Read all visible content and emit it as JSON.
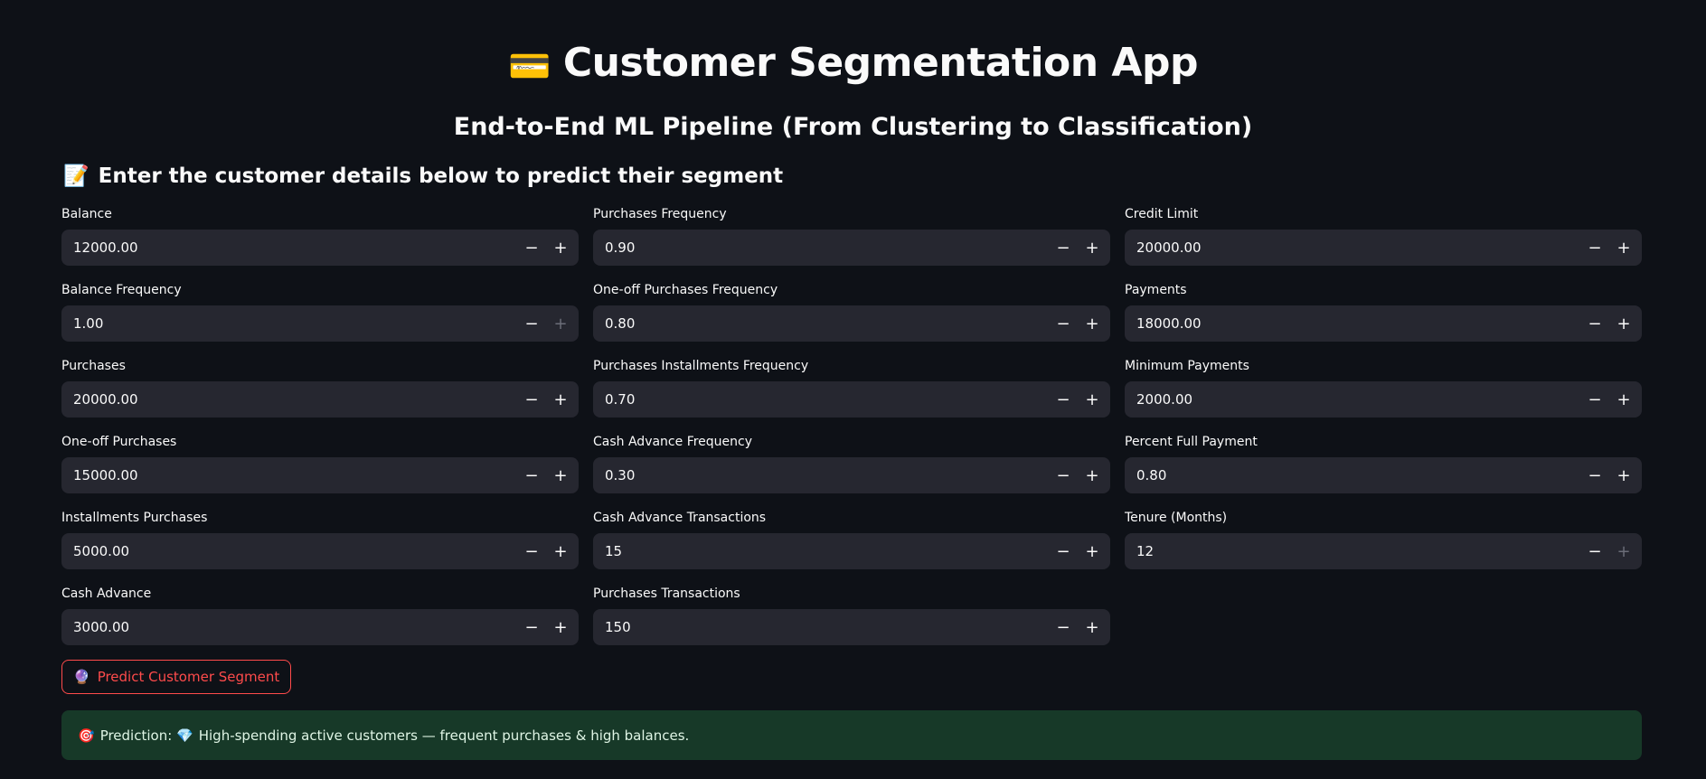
{
  "header": {
    "title_emoji": "💳",
    "title": "Customer Segmentation App",
    "subtitle": "End-to-End ML Pipeline (From Clustering to Classification)"
  },
  "form": {
    "heading_emoji": "📝",
    "heading": "Enter the customer details below to predict their segment",
    "fields": [
      {
        "label": "Balance",
        "value": "12000.00"
      },
      {
        "label": "Balance Frequency",
        "value": "1.00"
      },
      {
        "label": "Purchases",
        "value": "20000.00"
      },
      {
        "label": "One-off Purchases",
        "value": "15000.00"
      },
      {
        "label": "Installments Purchases",
        "value": "5000.00"
      },
      {
        "label": "Cash Advance",
        "value": "3000.00"
      },
      {
        "label": "Purchases Frequency",
        "value": "0.90"
      },
      {
        "label": "One-off Purchases Frequency",
        "value": "0.80"
      },
      {
        "label": "Purchases Installments Frequency",
        "value": "0.70"
      },
      {
        "label": "Cash Advance Frequency",
        "value": "0.30"
      },
      {
        "label": "Cash Advance Transactions",
        "value": "15"
      },
      {
        "label": "Purchases Transactions",
        "value": "150"
      },
      {
        "label": "Credit Limit",
        "value": "20000.00"
      },
      {
        "label": "Payments",
        "value": "18000.00"
      },
      {
        "label": "Minimum Payments",
        "value": "2000.00"
      },
      {
        "label": "Percent Full Payment",
        "value": "0.80"
      },
      {
        "label": "Tenure (Months)",
        "value": "12"
      }
    ],
    "minus_symbol": "−",
    "plus_symbol": "+"
  },
  "predict_button": {
    "emoji": "🔮",
    "label": "Predict Customer Segment"
  },
  "result": {
    "prefix_emoji": "🎯",
    "prefix": "Prediction:",
    "segment_emoji": "💎",
    "text": "High-spending active customers — frequent purchases & high balances."
  },
  "colors": {
    "background": "#0e1117",
    "input_bg": "#262730",
    "accent": "#ff4b4b",
    "success_bg": "#173928"
  }
}
